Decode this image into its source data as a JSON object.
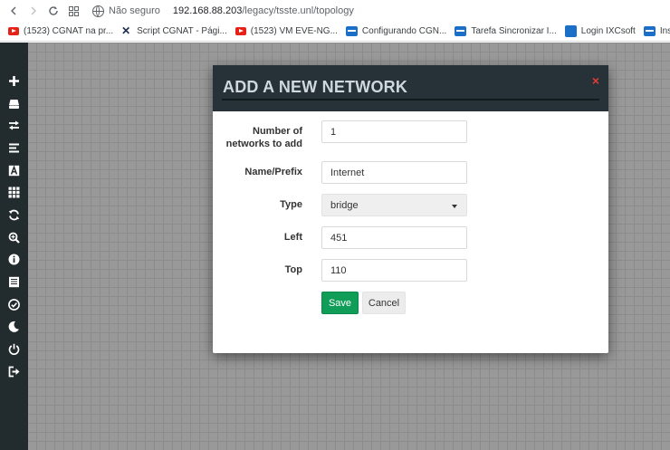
{
  "browser": {
    "not_secure": "Não seguro",
    "url_host": "192.168.88.203",
    "url_path": "/legacy/tsste.unl/topology",
    "bookmarks": [
      {
        "icon": "youtube-icon",
        "label": "(1523) CGNAT na pr..."
      },
      {
        "icon": "x-logo-icon",
        "label": "Script CGNAT - Pági..."
      },
      {
        "icon": "youtube-icon",
        "label": "(1523) VM EVE-NG..."
      },
      {
        "icon": "eve-ng-icon",
        "label": "Configurando CGN..."
      },
      {
        "icon": "eve-ng-icon",
        "label": "Tarefa Sincronizar I..."
      },
      {
        "icon": "ixc-icon",
        "label": "Login IXCsoft"
      },
      {
        "icon": "eve-ng-icon",
        "label": "Instalação EVE-NG..."
      }
    ]
  },
  "sidebar": {
    "items": [
      "add-icon",
      "node-icon",
      "connect-icon",
      "list-icon",
      "text-icon",
      "grid-icon",
      "refresh-icon",
      "zoom-icon",
      "info-icon",
      "notes-icon",
      "check-icon",
      "moon-icon",
      "power-icon",
      "logout-icon"
    ]
  },
  "modal": {
    "title": "ADD A NEW NETWORK",
    "close": "×",
    "fields": {
      "count_label_1": "Number of",
      "count_label_2": "networks to add",
      "count_value": "1",
      "name_label": "Name/Prefix",
      "name_value": "Internet",
      "type_label": "Type",
      "type_value": "bridge",
      "left_label": "Left",
      "left_value": "451",
      "top_label": "Top",
      "top_value": "110"
    },
    "save_label": "Save",
    "cancel_label": "Cancel"
  },
  "colors": {
    "sidebar_bg": "#222b2e",
    "modal_header_bg": "#263238",
    "save_green": "#0f9d58",
    "close_red": "#e53935"
  }
}
